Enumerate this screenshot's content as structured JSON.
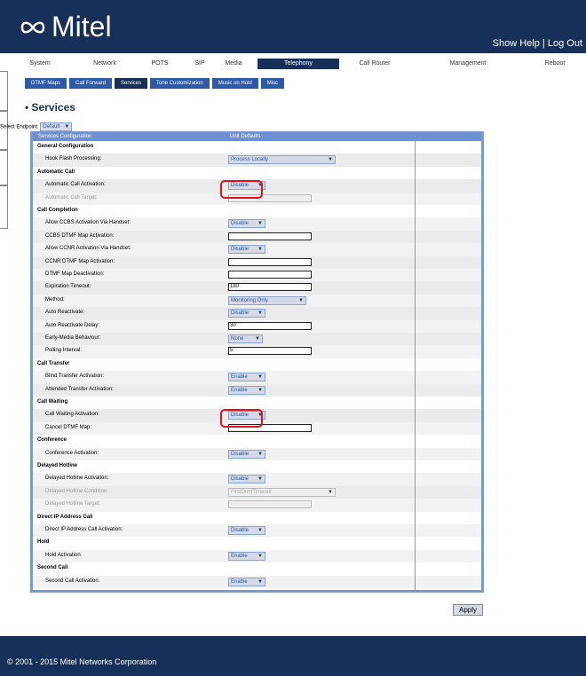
{
  "header": {
    "brand": "Mitel",
    "links": [
      "Show Help",
      "Log Out"
    ]
  },
  "main_nav": [
    "System",
    "Network",
    "POTS",
    "SIP",
    "Media",
    "Telephony",
    "Call Router",
    "Management",
    "Reboot"
  ],
  "main_nav_active": "Telephony",
  "sub_nav": [
    "DTMF Maps",
    "Call Forward",
    "Services",
    "Tone Customization",
    "Music on Hold",
    "Misc"
  ],
  "sub_nav_active": "Services",
  "page_title": "Services",
  "endpoint": {
    "label": "Select Endpoint:",
    "value": "Default"
  },
  "table": {
    "col1": "Services Configuration",
    "col2": "Unit Defaults",
    "rows": [
      {
        "t": "sec",
        "label": "General Configuration"
      },
      {
        "t": "item",
        "label": "Hook Flash Processing:",
        "ctl": "sel",
        "value": "Process Locally",
        "w": 115
      },
      {
        "t": "sec",
        "label": "Automatic Call"
      },
      {
        "t": "item",
        "label": "Automatic Call Activation:",
        "ctl": "sel",
        "value": "Disable",
        "w": 36
      },
      {
        "t": "item",
        "label": "Automatic Call Target:",
        "ctl": "txt",
        "value": "",
        "dis": true
      },
      {
        "t": "sec",
        "label": "Call Completion"
      },
      {
        "t": "item",
        "label": "Allow CCBS Activation Via Handset:",
        "ctl": "sel",
        "value": "Disable",
        "w": 36
      },
      {
        "t": "item",
        "label": "CCBS DTMF Map Activation:",
        "ctl": "txt",
        "value": ""
      },
      {
        "t": "item",
        "label": "Allow CCNR Activation Via Handset:",
        "ctl": "sel",
        "value": "Disable",
        "w": 36
      },
      {
        "t": "item",
        "label": "CCNR DTMF Map Activation:",
        "ctl": "txt",
        "value": ""
      },
      {
        "t": "item",
        "label": "DTMF Map Deactivation:",
        "ctl": "txt",
        "value": ""
      },
      {
        "t": "item",
        "label": "Expiration Timeout:",
        "ctl": "txt",
        "value": "180"
      },
      {
        "t": "item",
        "label": "Method:",
        "ctl": "sel",
        "value": "Monitoring Only",
        "w": 82
      },
      {
        "t": "item",
        "label": "Auto Reactivate:",
        "ctl": "sel",
        "value": "Disable",
        "w": 36
      },
      {
        "t": "item",
        "label": "Auto Reactivate Delay:",
        "ctl": "txt",
        "value": "30"
      },
      {
        "t": "item",
        "label": "Early-Media Behaviour:",
        "ctl": "sel",
        "value": "None",
        "w": 33
      },
      {
        "t": "item",
        "label": "Polling Interval:",
        "ctl": "txt",
        "value": "5"
      },
      {
        "t": "sec",
        "label": "Call Transfer"
      },
      {
        "t": "item",
        "label": "Blind Transfer Activation:",
        "ctl": "sel",
        "value": "Enable",
        "w": 36
      },
      {
        "t": "item",
        "label": "Attended Transfer Activation:",
        "ctl": "sel",
        "value": "Enable",
        "w": 36
      },
      {
        "t": "sec",
        "label": "Call Waiting"
      },
      {
        "t": "item",
        "label": "Call Waiting Activation:",
        "ctl": "sel",
        "value": "Disable",
        "w": 36
      },
      {
        "t": "item",
        "label": "Cancel DTMF Map:",
        "ctl": "txt",
        "value": ""
      },
      {
        "t": "sec",
        "label": "Conference"
      },
      {
        "t": "item",
        "label": "Conference Activation:",
        "ctl": "sel",
        "value": "Disable",
        "w": 36
      },
      {
        "t": "sec",
        "label": "Delayed Hotline"
      },
      {
        "t": "item",
        "label": "Delayed Hotline Activation:",
        "ctl": "sel",
        "value": "Disable",
        "w": 36
      },
      {
        "t": "item",
        "label": "Delayed Hotline Condition:",
        "ctl": "sel",
        "value": "FirstDtmfTimeout",
        "w": 115,
        "dis": true
      },
      {
        "t": "item",
        "label": "Delayed Hotline Target:",
        "ctl": "txt",
        "value": "",
        "dis": true
      },
      {
        "t": "sec",
        "label": "Direct IP Address Call"
      },
      {
        "t": "item",
        "label": "Direct IP Address Call Activation:",
        "ctl": "sel",
        "value": "Disable",
        "w": 36
      },
      {
        "t": "sec",
        "label": "Hold"
      },
      {
        "t": "item",
        "label": "Hold Activation:",
        "ctl": "sel",
        "value": "Enable",
        "w": 36
      },
      {
        "t": "sec",
        "label": "Second Call"
      },
      {
        "t": "item",
        "label": "Second Call Activation:",
        "ctl": "sel",
        "value": "Enable",
        "w": 36
      }
    ]
  },
  "apply_label": "Apply",
  "footer": "© 2001 - 2015 Mitel Networks Corporation"
}
